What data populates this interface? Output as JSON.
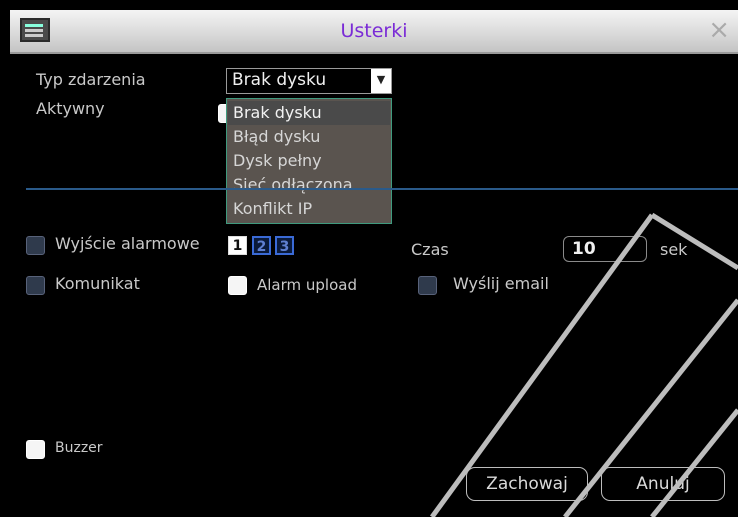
{
  "window": {
    "title": "Usterki",
    "close_glyph": "×",
    "icon": "window-menu-icon"
  },
  "event": {
    "type_label": "Typ zdarzenia",
    "type_value": "Brak dysku",
    "active_label": "Aktywny",
    "active_checked": true,
    "options": [
      "Brak dysku",
      "Błąd dysku",
      "Dysk pełny",
      "Sieć odłączona",
      "Konflikt IP"
    ],
    "selected_index": 0
  },
  "alarm": {
    "output_label": "Wyjście alarmowe",
    "output_checked": false,
    "channels": [
      {
        "label": "1",
        "checked": true
      },
      {
        "label": "2",
        "checked": false
      },
      {
        "label": "3",
        "checked": false
      }
    ],
    "time_label": "Czas",
    "time_value": "10",
    "time_unit": "sek",
    "message_label": "Komunikat",
    "message_checked": false,
    "upload_label": "Alarm upload",
    "upload_checked": true,
    "email_label": "Wyślij email",
    "email_checked": false,
    "buzzer_label": "Buzzer",
    "buzzer_checked": true
  },
  "buttons": {
    "save": "Zachowaj",
    "cancel": "Anuluj"
  },
  "colors": {
    "title": "#7a2bd6",
    "separator": "#2a5a8a",
    "dropdown_border": "#3f9a7e",
    "overlay_lines": "#bdbdbd"
  }
}
